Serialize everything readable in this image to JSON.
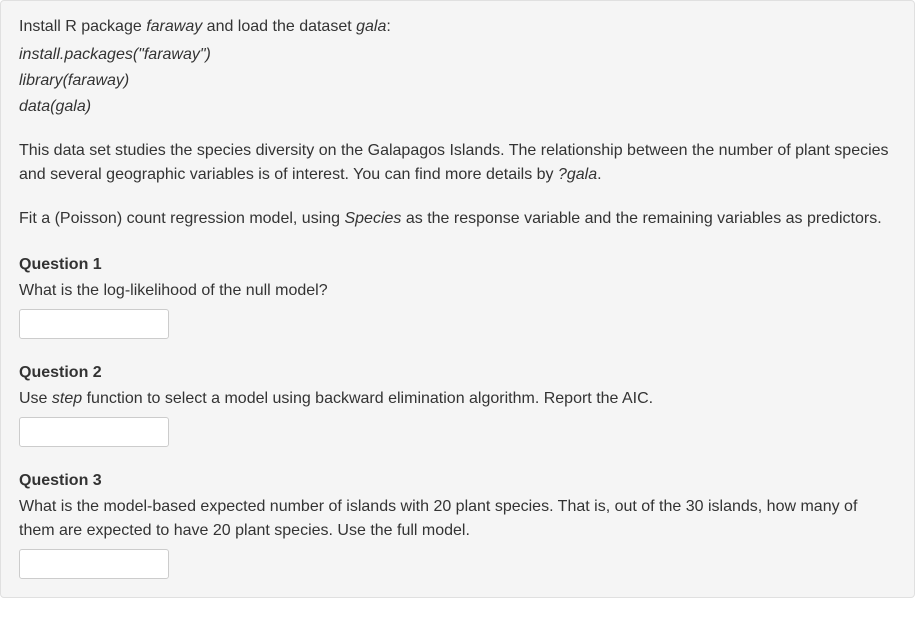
{
  "intro": {
    "line1_a": "Install R package ",
    "line1_b": "faraway",
    "line1_c": " and load the dataset ",
    "line1_d": "gala",
    "line1_e": ":",
    "code1": "install.packages(\"faraway\")",
    "code2": "library(faraway)",
    "code3": "data(gala)",
    "p1_a": "This data set studies the species diversity on the Galapagos Islands. The relationship between the number of plant species and several geographic variables is of interest. You can find more details by ",
    "p1_b": "?gala",
    "p1_c": ".",
    "p2_a": "Fit a (Poisson) count regression model, using ",
    "p2_b": "Species",
    "p2_c": " as the response variable and the remaining variables as predictors."
  },
  "questions": [
    {
      "title": "Question 1",
      "prompt_a": "What is the log-likelihood of the null model?",
      "prompt_b": "",
      "prompt_c": ""
    },
    {
      "title": "Question 2",
      "prompt_a": "Use ",
      "prompt_b": "step",
      "prompt_c": " function to select a model using backward elimination algorithm. Report the AIC."
    },
    {
      "title": "Question 3",
      "prompt_a": "What is the model-based expected number of islands with 20 plant species. That is, out of the 30 islands, how many of them are expected to have 20 plant species. Use the full model.",
      "prompt_b": "",
      "prompt_c": ""
    }
  ]
}
